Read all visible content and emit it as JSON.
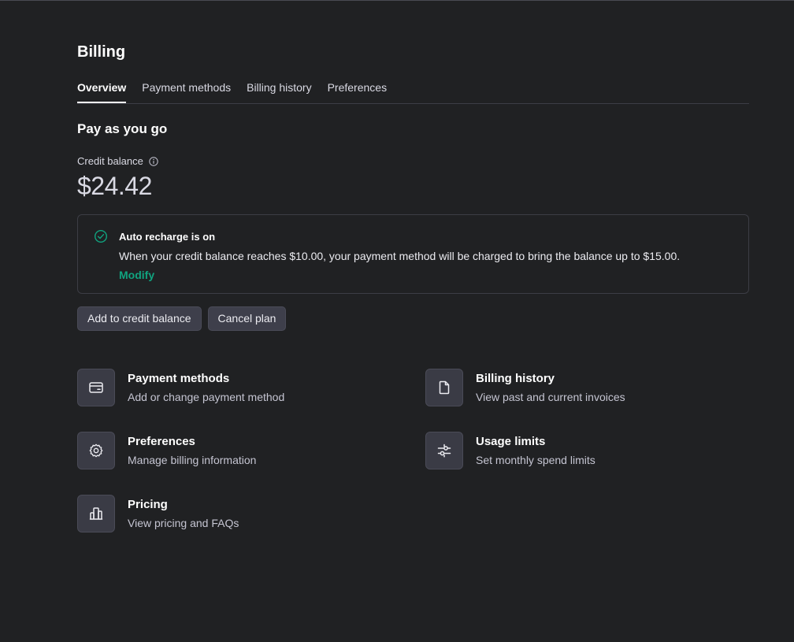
{
  "page": {
    "title": "Billing"
  },
  "tabs": [
    {
      "label": "Overview",
      "active": true
    },
    {
      "label": "Payment methods",
      "active": false
    },
    {
      "label": "Billing history",
      "active": false
    },
    {
      "label": "Preferences",
      "active": false
    }
  ],
  "plan": {
    "title": "Pay as you go",
    "credit_label": "Credit balance",
    "credit_info_icon": "info-circle-icon",
    "balance": "$24.42"
  },
  "recharge": {
    "icon": "check-circle-icon",
    "title": "Auto recharge is on",
    "description": "When your credit balance reaches $10.00, your payment method will be charged to bring the balance up to $15.00.",
    "modify_label": "Modify"
  },
  "actions": {
    "add_credit_label": "Add to credit balance",
    "cancel_plan_label": "Cancel plan"
  },
  "cards": [
    {
      "title": "Payment methods",
      "subtitle": "Add or change payment method",
      "icon": "credit-card-icon"
    },
    {
      "title": "Billing history",
      "subtitle": "View past and current invoices",
      "icon": "document-icon"
    },
    {
      "title": "Preferences",
      "subtitle": "Manage billing information",
      "icon": "gear-icon"
    },
    {
      "title": "Usage limits",
      "subtitle": "Set monthly spend limits",
      "icon": "sliders-icon"
    },
    {
      "title": "Pricing",
      "subtitle": "View pricing and FAQs",
      "icon": "bar-chart-icon"
    }
  ],
  "colors": {
    "background": "#202123",
    "accent_green": "#10a37f",
    "button_bg": "#3e3f4b",
    "border": "#3c3d45"
  }
}
